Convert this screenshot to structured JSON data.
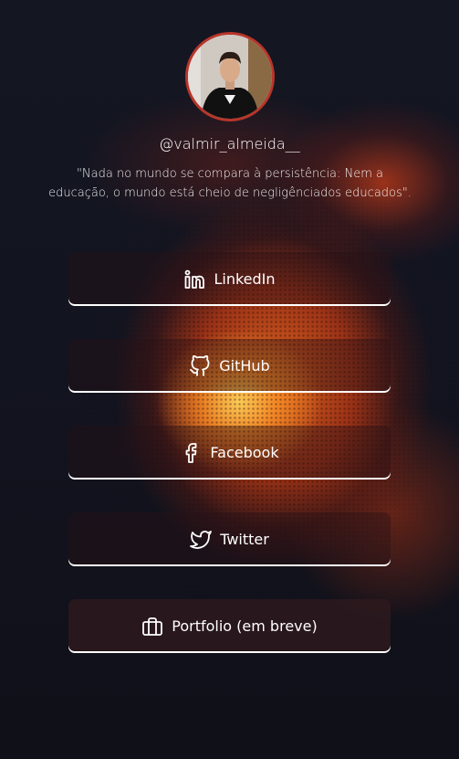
{
  "profile": {
    "username": "@valmir_almeida__",
    "quote": "\"Nada no mundo se compara à persistência: Nem a educação, o mundo está cheio de negligênciados educados\"."
  },
  "links": [
    {
      "label": "LinkedIn",
      "icon": "linkedin-icon"
    },
    {
      "label": "GitHub",
      "icon": "github-icon"
    },
    {
      "label": "Facebook",
      "icon": "facebook-icon"
    },
    {
      "label": "Twitter",
      "icon": "twitter-icon"
    },
    {
      "label": "Portfolio (em breve)",
      "icon": "briefcase-icon"
    }
  ],
  "colors": {
    "background": "#14141c",
    "avatar_border": "#b8352a",
    "text": "#ffffff"
  }
}
